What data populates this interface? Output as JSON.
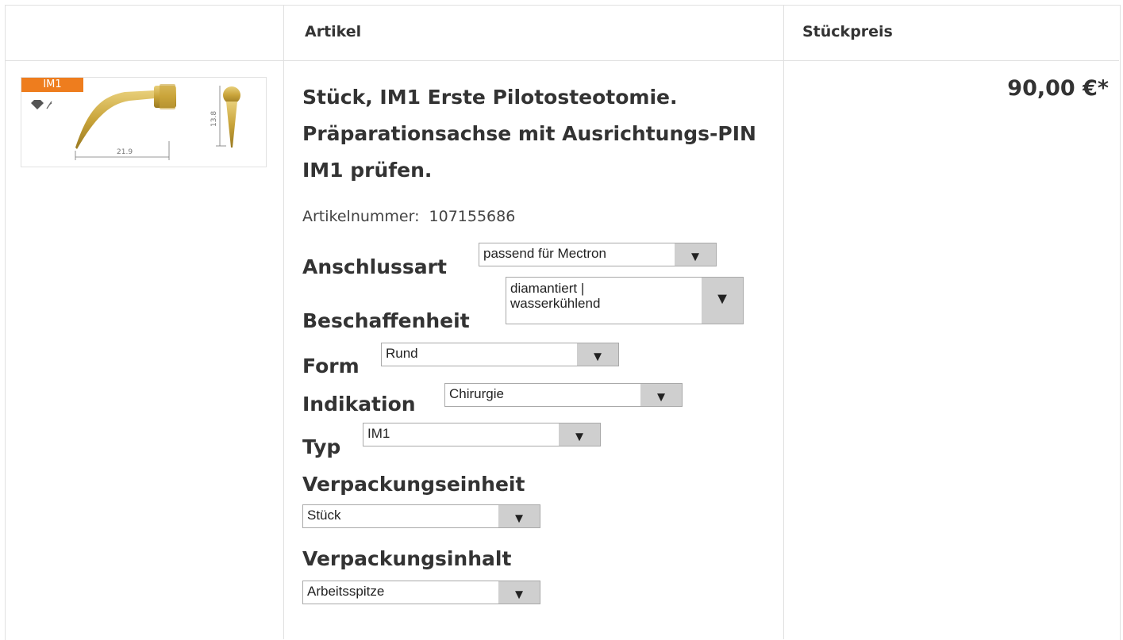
{
  "table": {
    "header": {
      "article": "Artikel",
      "unit_price": "Stückpreis"
    }
  },
  "product": {
    "thumbnail": {
      "badge": "IM1",
      "dim_length": "21.9",
      "dim_height": "13.8",
      "icon_names": [
        "diamond-icon",
        "water-cooling-icon"
      ]
    },
    "title": "Stück, IM1 Erste Pilotosteotomie. Präparationsachse mit Ausrichtungs-PIN IM1 prüfen.",
    "article_number_label": "Artikelnummer:",
    "article_number": "107155686",
    "price": "90,00 €*",
    "options": {
      "anschlussart": {
        "label": "Anschlussart",
        "value": "passend für Mectron"
      },
      "beschaffenheit": {
        "label": "Beschaffenheit",
        "value_line1": "diamantiert |",
        "value_line2": "wasserkühlend"
      },
      "form": {
        "label": "Form",
        "value": "Rund"
      },
      "indikation": {
        "label": "Indikation",
        "value": "Chirurgie"
      },
      "typ": {
        "label": "Typ",
        "value": "IM1"
      },
      "verpackungseinheit": {
        "label": "Verpackungseinheit",
        "value": "Stück"
      },
      "verpackungsinhalt": {
        "label": "Verpackungsinhalt",
        "value": "Arbeitsspitze"
      }
    },
    "dropdown_arrow": "▼"
  },
  "colors": {
    "badge": "#ee7d1e",
    "gold": "#c9a43a",
    "arrow_bg": "#cfcfcf",
    "border": "#e0e0e0"
  }
}
